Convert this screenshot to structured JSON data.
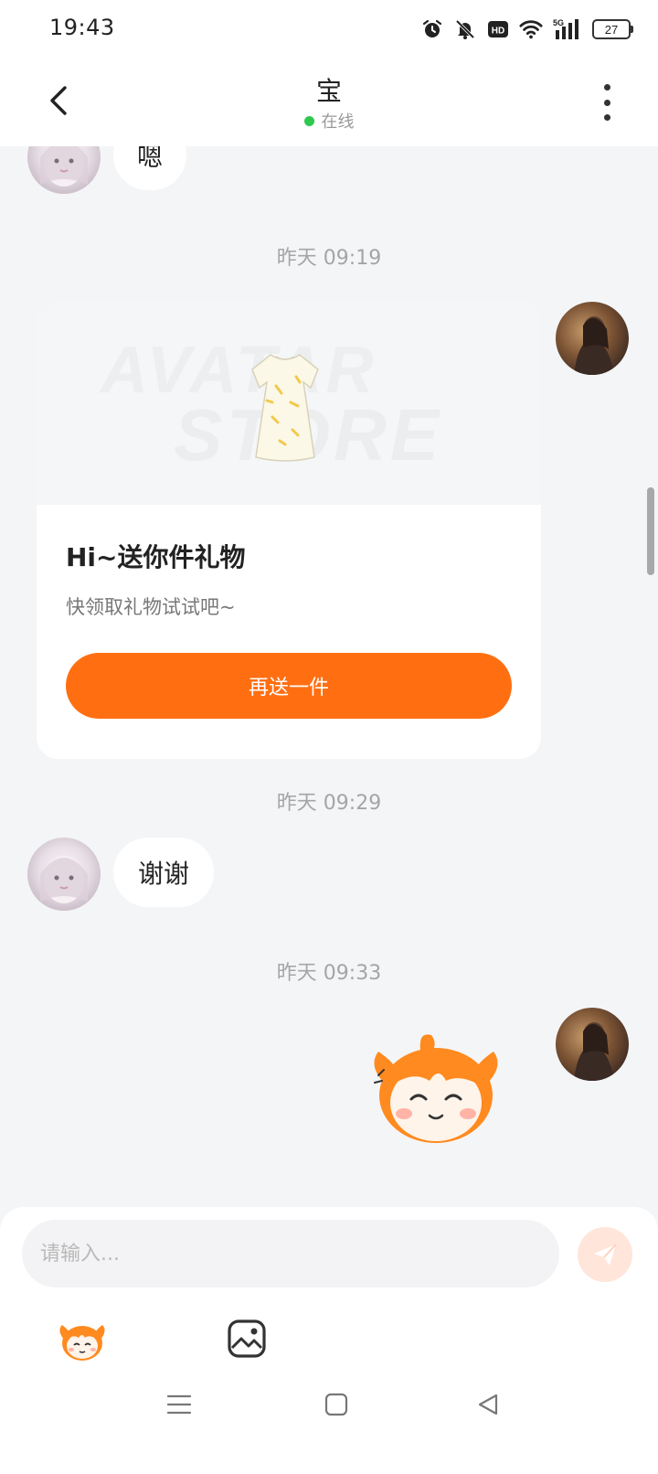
{
  "status_bar": {
    "time": "19:43",
    "battery": "27",
    "network": "5G"
  },
  "header": {
    "contact_name": "宝",
    "online_status": "在线",
    "online_color": "#2dc84d"
  },
  "messages": {
    "msg1_text": "嗯",
    "ts1": "昨天 09:19",
    "gift_card": {
      "watermark_line1": "AVATAR",
      "watermark_line2": "STORE",
      "title": "Hi~送你件礼物",
      "subtitle": "快领取礼物试试吧~",
      "button": "再送一件",
      "button_color": "#ff6f12"
    },
    "ts2": "昨天 09:29",
    "msg2_text": "谢谢",
    "ts3": "昨天 09:33",
    "sticker": "mascot-smile-sticker"
  },
  "input_panel": {
    "placeholder": "请输入...",
    "send_icon": "send-plane-icon",
    "emoji_icon": "mascot-emoji-icon",
    "image_icon": "image-icon"
  },
  "nav": {
    "menu_icon": "menu-icon",
    "home_icon": "home-square-icon",
    "back_icon": "back-triangle-icon"
  }
}
